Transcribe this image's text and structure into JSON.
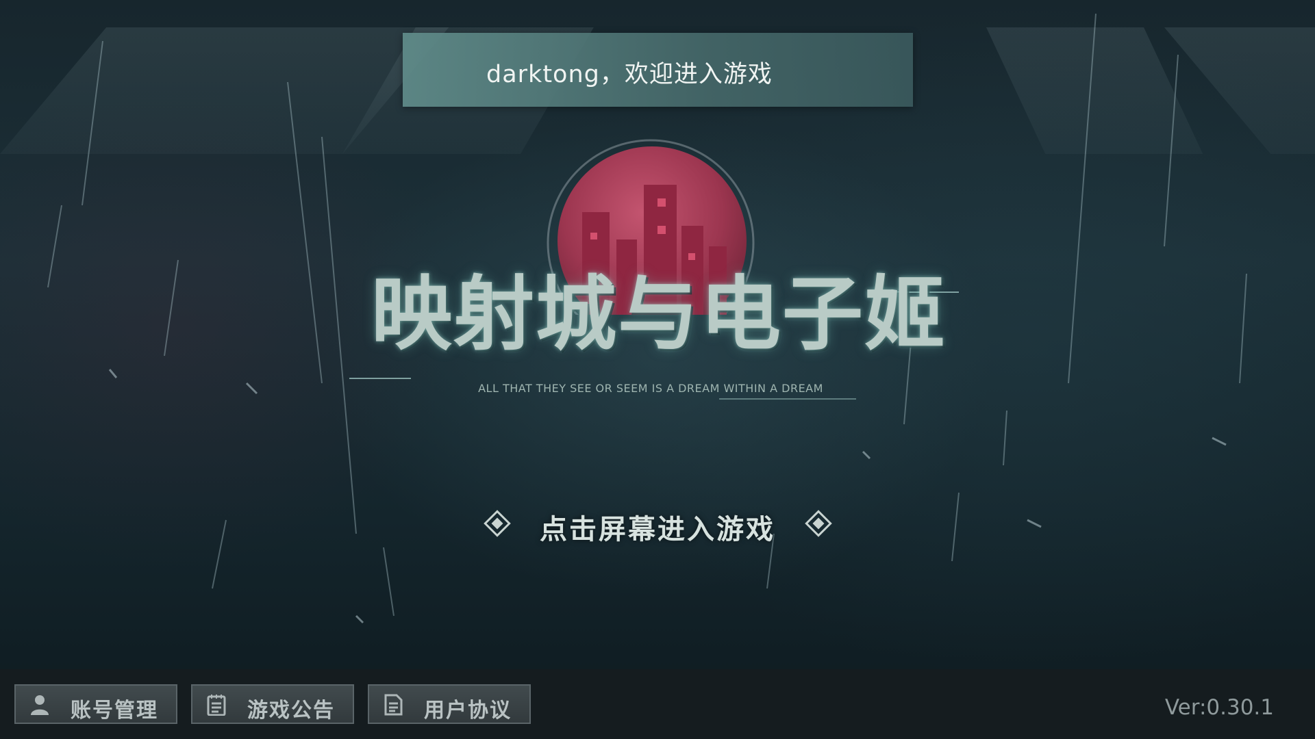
{
  "welcome": {
    "text": "darktong，欢迎进入游戏"
  },
  "logo": {
    "title": "映射城与电子姬",
    "subtitle": "ALL THAT THEY SEE OR SEEM IS A DREAM WITHIN A DREAM"
  },
  "prompt": {
    "text": "点击屏幕进入游戏"
  },
  "menu": {
    "account_label": "账号管理",
    "notice_label": "游戏公告",
    "agreement_label": "用户协议"
  },
  "version": "Ver:0.30.1",
  "icons": {
    "account": "person-icon",
    "notice": "notepad-icon",
    "agreement": "document-icon",
    "prompt_left": "diamond-icon",
    "prompt_right": "diamond-icon"
  },
  "colors": {
    "welcome_bar": "#5f8c8a",
    "logo_moon": "#c2415d",
    "bottom_bar": "#161c1f"
  }
}
